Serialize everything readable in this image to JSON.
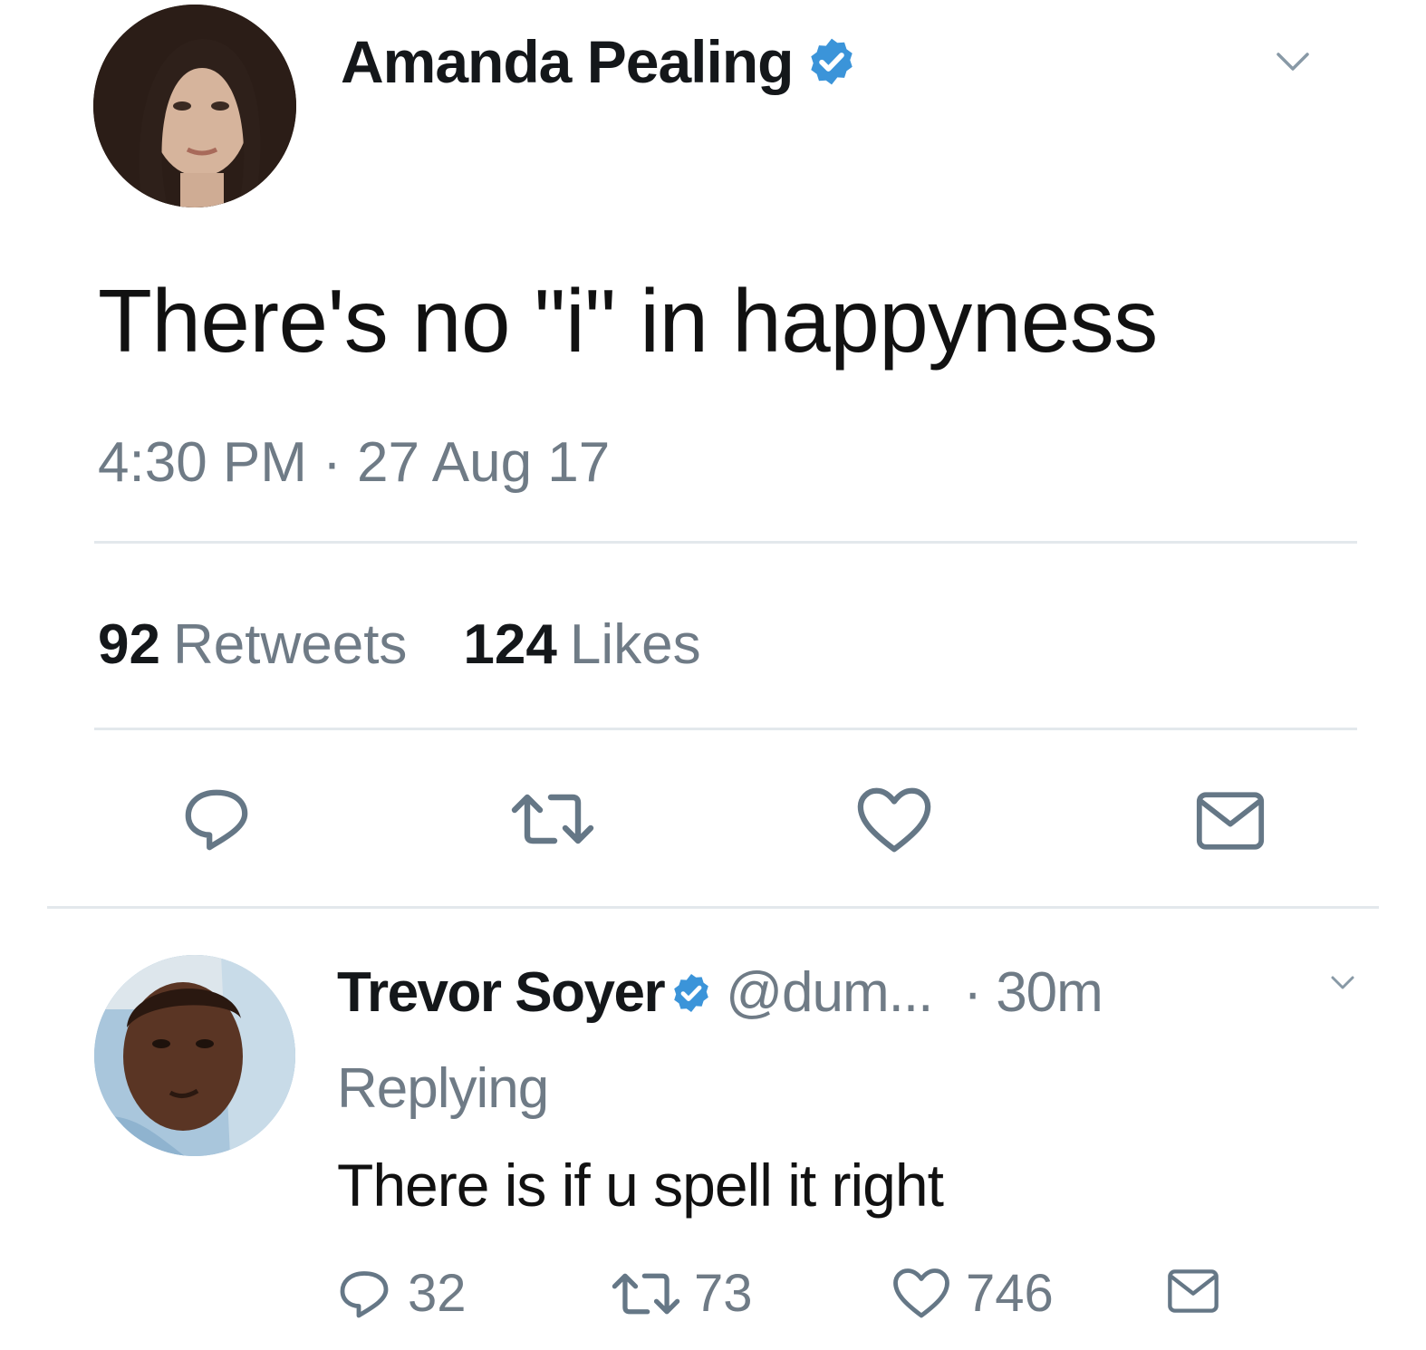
{
  "colors": {
    "text_primary": "#14171a",
    "text_secondary": "#6f7b86",
    "icon_gray": "#657786",
    "verified_blue": "#3b94d9",
    "divider": "#e3e8ec"
  },
  "main_tweet": {
    "author_name": "Amanda Pealing",
    "verified_icon": "verified-badge-icon",
    "text": "There's no \"i\" in happyness",
    "timestamp": "4:30 PM · 27 Aug 17",
    "retweets_count": "92",
    "retweets_label": "Retweets",
    "likes_count": "124",
    "likes_label": "Likes",
    "actions": [
      "reply-icon",
      "retweet-icon",
      "like-icon",
      "direct-message-icon"
    ]
  },
  "reply_tweet": {
    "author_name": "Trevor Soyer",
    "verified_icon": "verified-badge-icon",
    "handle": "@dum...",
    "time": "· 30m",
    "context": "Replying",
    "text": "There is if u spell it right",
    "reply_count": "32",
    "retweet_count": "73",
    "like_count": "746"
  }
}
